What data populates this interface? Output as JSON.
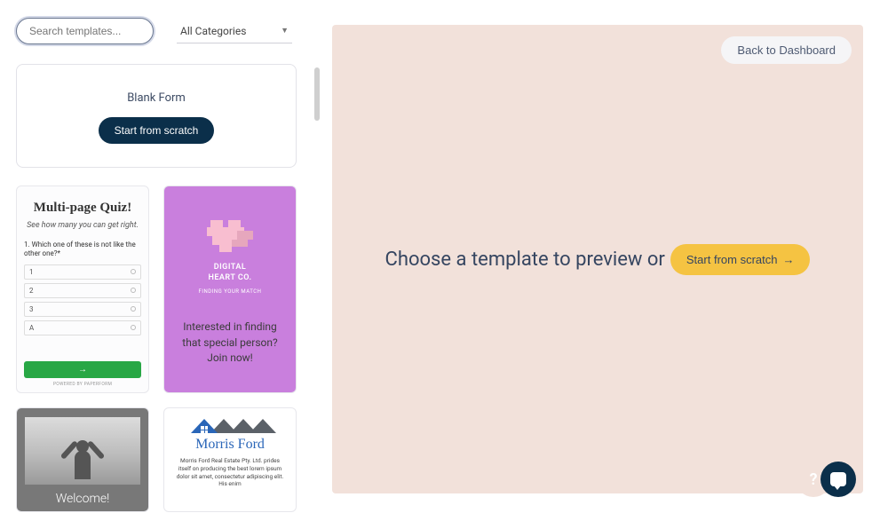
{
  "search": {
    "placeholder": "Search templates..."
  },
  "category": {
    "label": "All Categories"
  },
  "blank": {
    "title": "Blank Form",
    "button": "Start from scratch"
  },
  "preview": {
    "back": "Back to Dashboard",
    "center_text": "Choose a template to preview or",
    "start_btn": "Start from scratch"
  },
  "templates": {
    "quiz": {
      "title": "Multi-page Quiz!",
      "subtitle": "See how many you can get right.",
      "question": "1. Which one of these is not like the other one?*",
      "options": [
        "1",
        "2",
        "3",
        "A"
      ],
      "go": "→",
      "powered": "POWERED BY PAPERFORM"
    },
    "heart": {
      "company_l1": "DIGITAL",
      "company_l2": "HEART CO.",
      "tagline": "FINDING YOUR MATCH",
      "message": "Interested in finding that special person? Join now!"
    },
    "welcome": {
      "label": "Welcome!"
    },
    "morris": {
      "name": "Morris Ford",
      "desc": "Morris Ford Real Estate Pty. Ltd. prides itself on producing the best lorem ipsum dolor sit amet, consectetur adipiscing elit. His enim"
    }
  }
}
